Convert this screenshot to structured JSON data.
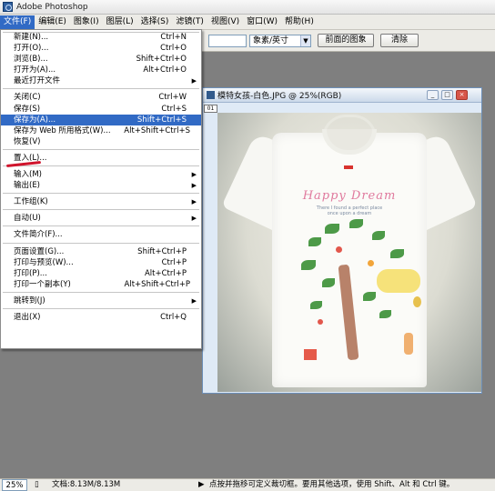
{
  "window": {
    "title": "Adobe Photoshop"
  },
  "menubar": [
    "文件(F)",
    "编辑(E)",
    "图象(I)",
    "图层(L)",
    "选择(S)",
    "滤镜(T)",
    "视图(V)",
    "窗口(W)",
    "帮助(H)"
  ],
  "toolbar": {
    "unit_select": "象素/英寸",
    "front_image_button": "前面的图象",
    "clear_button": "清除"
  },
  "document": {
    "title": "模特女孩-白色.JPG @ 25%(RGB)",
    "ruler_box": "01",
    "artwork": {
      "title": "Happy Dream",
      "subtitle_line1": "There I found a perfect place",
      "subtitle_line2": "once upon a dream"
    }
  },
  "file_menu": {
    "groups": [
      [
        {
          "label": "新建(N)...",
          "shortcut": "Ctrl+N"
        },
        {
          "label": "打开(O)...",
          "shortcut": "Ctrl+O"
        },
        {
          "label": "浏览(B)...",
          "shortcut": "Shift+Ctrl+O"
        },
        {
          "label": "打开为(A)...",
          "shortcut": "Alt+Ctrl+O"
        },
        {
          "label": "最近打开文件",
          "submenu": true
        }
      ],
      [
        {
          "label": "关闭(C)",
          "shortcut": "Ctrl+W"
        },
        {
          "label": "保存(S)",
          "shortcut": "Ctrl+S"
        },
        {
          "label": "保存为(A)...",
          "shortcut": "Shift+Ctrl+S",
          "highlighted": true
        },
        {
          "label": "保存为 Web 所用格式(W)...",
          "shortcut": "Alt+Shift+Ctrl+S"
        },
        {
          "label": "恢复(V)"
        }
      ],
      [
        {
          "label": "置入(L)..."
        }
      ],
      [
        {
          "label": "输入(M)",
          "submenu": true
        },
        {
          "label": "输出(E)",
          "submenu": true
        }
      ],
      [
        {
          "label": "工作组(K)",
          "submenu": true
        }
      ],
      [
        {
          "label": "自动(U)",
          "submenu": true
        }
      ],
      [
        {
          "label": "文件简介(F)..."
        }
      ],
      [
        {
          "label": "页面设置(G)...",
          "shortcut": "Shift+Ctrl+P"
        },
        {
          "label": "打印与预览(W)...",
          "shortcut": "Ctrl+P"
        },
        {
          "label": "打印(P)...",
          "shortcut": "Alt+Ctrl+P"
        },
        {
          "label": "打印一个副本(Y)",
          "shortcut": "Alt+Shift+Ctrl+P"
        }
      ],
      [
        {
          "label": "跳转到(J)",
          "submenu": true
        }
      ],
      [
        {
          "label": "退出(X)",
          "shortcut": "Ctrl+Q"
        }
      ]
    ]
  },
  "statusbar": {
    "zoom": "25%",
    "doc_size": "文档:8.13M/8.13M",
    "hint": "点按并拖移可定义裁切框。要用其他选项，使用 Shift、Alt 和 Ctrl 键。"
  },
  "colors": {
    "highlight": "#316ac5",
    "annotation_red": "#d0142c"
  },
  "icons": {
    "window_min": "minimize-icon",
    "window_max": "maximize-icon",
    "window_close": "close-icon",
    "submenu": "chevron-right-icon"
  }
}
